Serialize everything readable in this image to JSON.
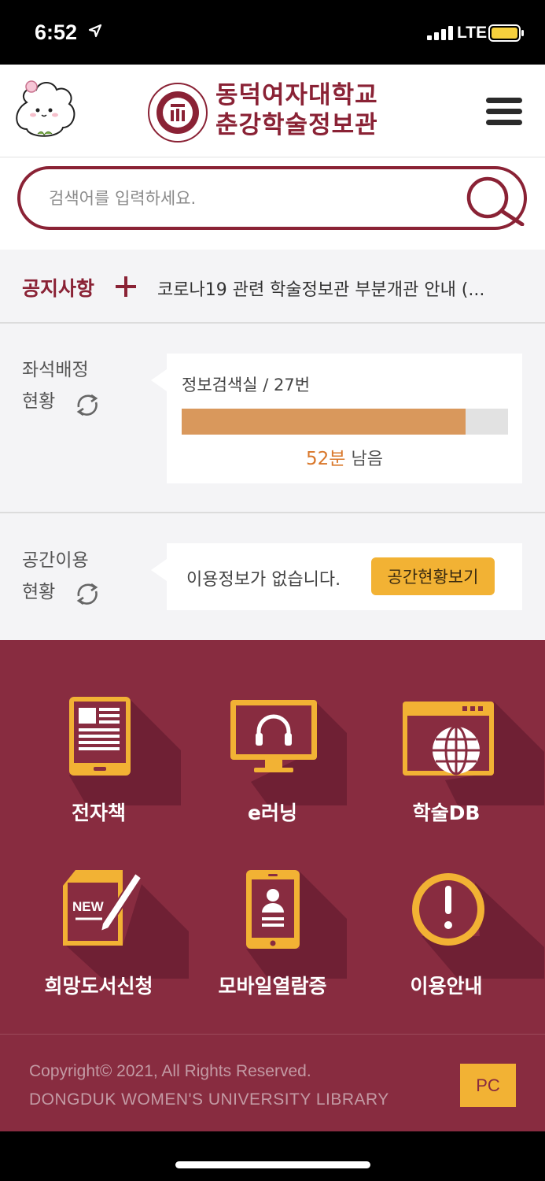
{
  "status_bar": {
    "time": "6:52",
    "network": "LTE"
  },
  "header": {
    "logo_line1": "동덕여자대학교",
    "logo_line2": "춘강학술정보관"
  },
  "search": {
    "placeholder": "검색어를 입력하세요."
  },
  "notice": {
    "label": "공지사항",
    "text": "코로나19 관련 학술정보관 부분개관 안내 (..."
  },
  "seat": {
    "label_line1": "좌석배정",
    "label_line2": "현황",
    "title": "정보검색실 / 27번",
    "remaining_minutes": "52분",
    "remaining_suffix": " 남음",
    "progress_fraction": 0.87
  },
  "space": {
    "label_line1": "공간이용",
    "label_line2": "현황",
    "message": "이용정보가 없습니다.",
    "button": "공간현황보기"
  },
  "menu": [
    {
      "label": "전자책",
      "icon": "ebook-icon"
    },
    {
      "label": "e러닝",
      "icon": "headphones-monitor-icon"
    },
    {
      "label": "학술DB",
      "icon": "globe-browser-icon"
    },
    {
      "label": "희망도서신청",
      "icon": "new-book-request-icon"
    },
    {
      "label": "모바일열람증",
      "icon": "mobile-id-card-icon"
    },
    {
      "label": "이용안내",
      "icon": "info-exclamation-icon"
    }
  ],
  "footer": {
    "copyright": "Copyright© 2021, All Rights Reserved.",
    "library": "DONGDUK WOMEN'S UNIVERSITY LIBRARY",
    "pc_button": "PC"
  },
  "colors": {
    "brand": "#8a2235",
    "grid_bg": "#882c40",
    "accent": "#f2b234",
    "progress": "#d9985c"
  }
}
